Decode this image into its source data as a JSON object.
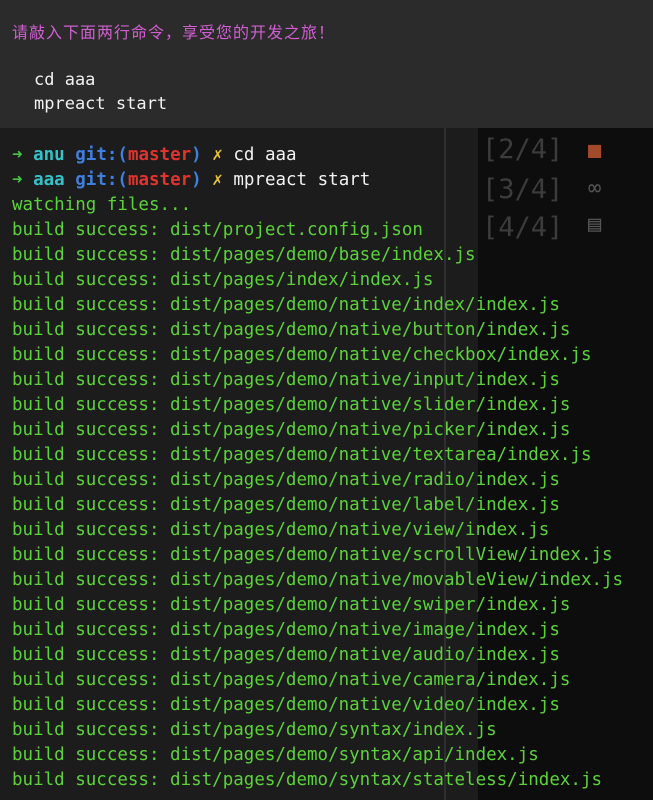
{
  "banner": {
    "message": "请敲入下面两行命令，享受您的开发之旅！",
    "commands": [
      "cd aaa",
      "mpreact start"
    ]
  },
  "terminal": {
    "prompts": [
      {
        "arrow": "➜",
        "dir": "anu",
        "git": "git:(",
        "branch": "master",
        "close": ")",
        "mark": "✗",
        "cmd": "cd aaa"
      },
      {
        "arrow": "➜",
        "dir": "aaa",
        "git": "git:(",
        "branch": "master",
        "close": ")",
        "mark": "✗",
        "cmd": "mpreact start"
      }
    ],
    "output": [
      "watching files...",
      "build success: dist/project.config.json",
      "build success: dist/pages/demo/base/index.js",
      "build success: dist/pages/index/index.js",
      "build success: dist/pages/demo/native/index/index.js",
      "build success: dist/pages/demo/native/button/index.js",
      "build success: dist/pages/demo/native/checkbox/index.js",
      "build success: dist/pages/demo/native/input/index.js",
      "build success: dist/pages/demo/native/slider/index.js",
      "build success: dist/pages/demo/native/picker/index.js",
      "build success: dist/pages/demo/native/textarea/index.js",
      "build success: dist/pages/demo/native/radio/index.js",
      "build success: dist/pages/demo/native/label/index.js",
      "build success: dist/pages/demo/native/view/index.js",
      "build success: dist/pages/demo/native/scrollView/index.js",
      "build success: dist/pages/demo/native/movableView/index.js",
      "build success: dist/pages/demo/native/swiper/index.js",
      "build success: dist/pages/demo/native/image/index.js",
      "build success: dist/pages/demo/native/audio/index.js",
      "build success: dist/pages/demo/native/camera/index.js",
      "build success: dist/pages/demo/native/video/index.js",
      "build success: dist/pages/demo/syntax/index.js",
      "build success: dist/pages/demo/syntax/api/index.js",
      "build success: dist/pages/demo/syntax/stateless/index.js"
    ]
  },
  "colors": {
    "banner_text": "#d25fd2",
    "success_green": "#5cd23a",
    "dir_cyan": "#36c1c9",
    "git_blue": "#3f7fe0",
    "branch_red": "#e0342e",
    "dirty_yellow": "#e6c23a"
  }
}
